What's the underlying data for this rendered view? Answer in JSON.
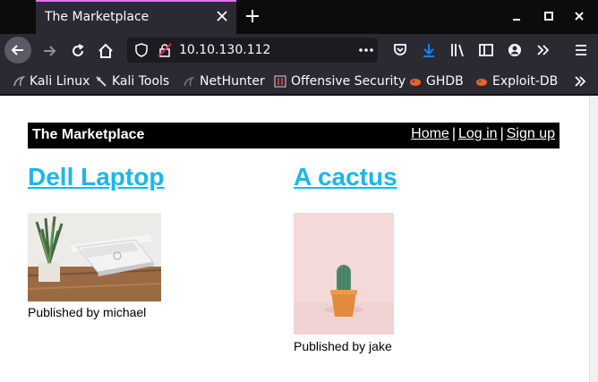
{
  "browser": {
    "tab_title": "The Marketplace",
    "url": "10.10.130.112",
    "bookmarks": [
      {
        "label": "Kali Linux",
        "icon": "kali-dragon-icon"
      },
      {
        "label": "Kali Tools",
        "icon": "kali-tools-icon"
      },
      {
        "label": "NetHunter",
        "icon": "nethunter-icon"
      },
      {
        "label": "Offensive Security",
        "icon": "offsec-icon"
      },
      {
        "label": "GHDB",
        "icon": "ghdb-icon"
      },
      {
        "label": "Exploit-DB",
        "icon": "exploitdb-icon"
      }
    ]
  },
  "page": {
    "site_title": "The Marketplace",
    "nav": {
      "home": "Home",
      "sep1": "|",
      "login": "Log in",
      "sep2": "|",
      "signup": "Sign up"
    },
    "listings": [
      {
        "title": "Dell Laptop",
        "published": "Published by michael",
        "image": "laptop-photo"
      },
      {
        "title": "A cactus",
        "published": "Published by jake",
        "image": "cactus-photo"
      }
    ]
  },
  "colors": {
    "link": "#1ab7ea",
    "header_bg": "#000000",
    "tab_accent": "#e66cf1"
  }
}
